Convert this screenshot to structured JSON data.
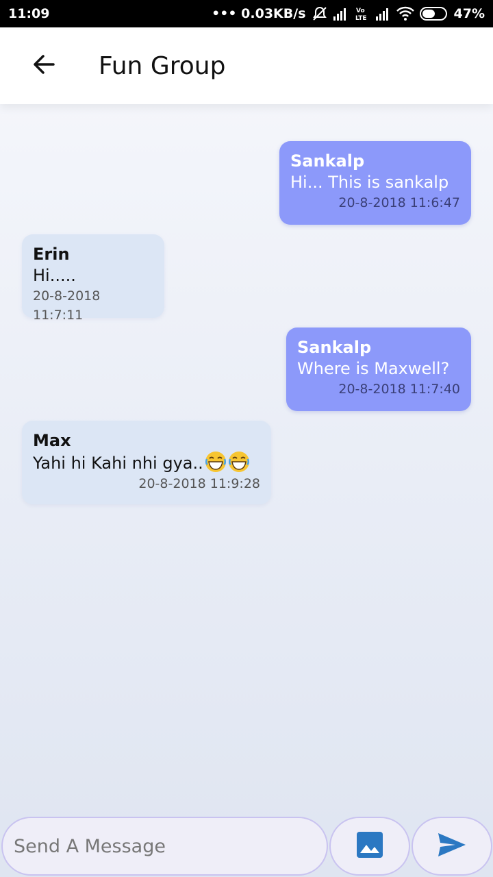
{
  "status_bar": {
    "time": "11:09",
    "network_speed": "••• 0.03KB/s",
    "battery_percent": "47%",
    "icons": [
      "bell-off-icon",
      "signal-icon",
      "volte-icon",
      "signal-icon",
      "wifi-icon",
      "battery-icon"
    ]
  },
  "app_bar": {
    "title": "Fun Group",
    "back_icon": "arrow-left-icon"
  },
  "messages": [
    {
      "sender": "Sankalp",
      "text": "Hi... This is sankalp",
      "time": "20-8-2018 11:6:47",
      "direction": "sent"
    },
    {
      "sender": "Erin",
      "text": "Hi.....",
      "time": "20-8-2018 11:7:11",
      "direction": "received"
    },
    {
      "sender": "Sankalp",
      "text": "Where is Maxwell?",
      "time": "20-8-2018 11:7:40",
      "direction": "sent"
    },
    {
      "sender": "Max",
      "text": "Yahi hi Kahi nhi gya..",
      "emoji": [
        "laughing-emoji",
        "laughing-emoji"
      ],
      "time": "20-8-2018 11:9:28",
      "direction": "received"
    }
  ],
  "composer": {
    "placeholder": "Send A Message",
    "image_button_icon": "image-icon",
    "send_button_icon": "send-icon"
  },
  "colors": {
    "sent_bubble": "#8c99fa",
    "received_bubble": "#dce6f5",
    "accent_icon": "#2b78c2",
    "composer_border": "#c9c3f0"
  }
}
